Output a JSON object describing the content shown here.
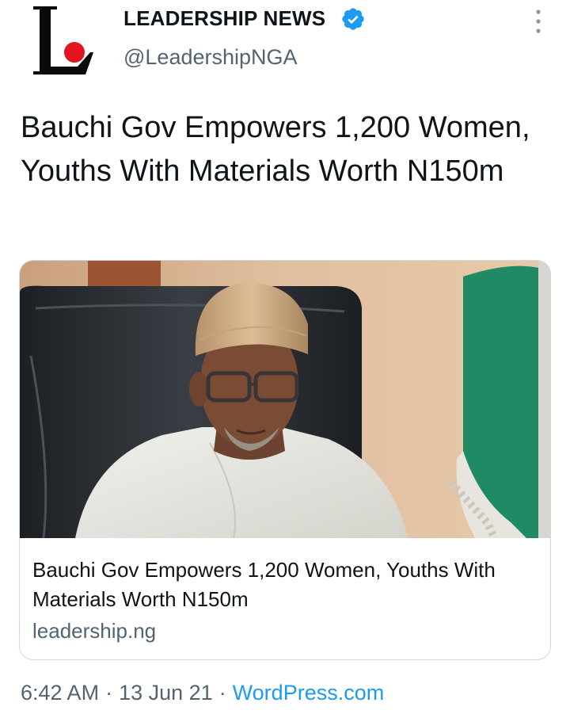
{
  "author": {
    "name": "LEADERSHIP NEWS",
    "handle": "@LeadershipNGA",
    "verified": true,
    "avatar_icon": "leadership-logo-icon",
    "logo_letter": "L"
  },
  "tweet": {
    "text": "Bauchi Gov Empowers 1,200 Women, Youths With Materials Worth N150m"
  },
  "card": {
    "title": "Bauchi Gov Empowers 1,200 Women, Youths With Materials Worth N150m",
    "domain": "leadership.ng",
    "image_icon": "article-photo"
  },
  "meta": {
    "time": "6:42 AM",
    "separator": "·",
    "date": "13 Jun 21",
    "source": "WordPress.com"
  },
  "colors": {
    "text": "#0f1419",
    "secondary": "#536471",
    "link": "#1d9bf0",
    "verified": "#1d9bf0",
    "logo_red": "#e3141b"
  }
}
